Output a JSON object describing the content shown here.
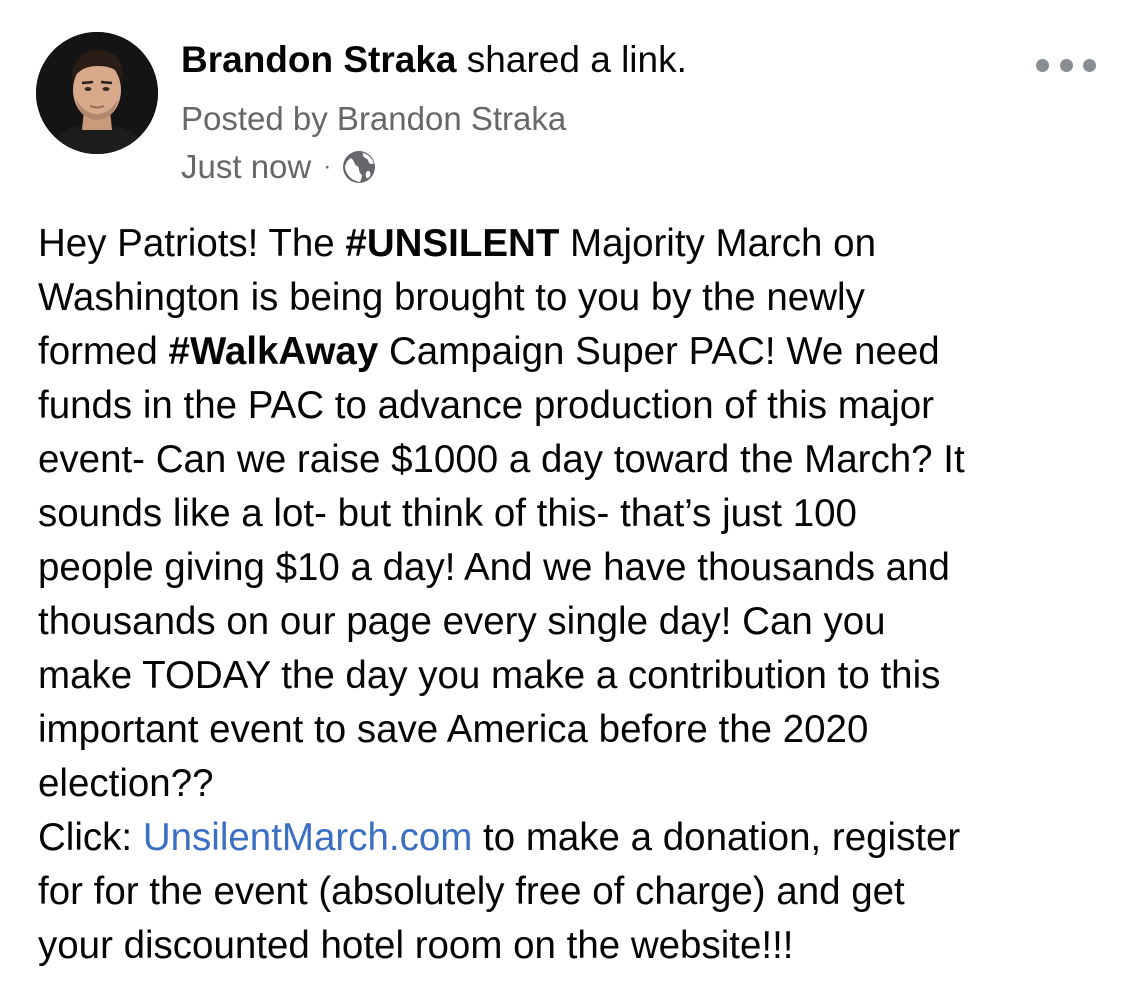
{
  "post": {
    "author": "Brandon Straka",
    "action": " shared a link.",
    "posted_by": "Posted by Brandon Straka",
    "timestamp": "Just now",
    "separator": "·",
    "privacy_icon": "globe-icon",
    "menu_icon": "more-options-icon",
    "body": {
      "line1_a": "Hey Patriots! The ",
      "line1_hashtag": "#UNSILENT",
      "line1_b": " Majority March on",
      "line2": "Washington is being brought to you by the newly",
      "line3_a": "formed ",
      "line3_hashtag": "#WalkAway",
      "line3_b": " Campaign Super PAC! We need",
      "line4": "funds in the PAC to advance production of this major",
      "line5": "event- Can we raise $1000 a day toward the March? It",
      "line6": "sounds like a lot- but think of this- that’s just 100",
      "line7": "people giving $10 a day! And we have thousands and",
      "line8": "thousands on our page every single day! Can you",
      "line9": "make TODAY the day you make a contribution to this",
      "line10": "important event to save America before the 2020",
      "line11": "election??",
      "line12_a": "Click: ",
      "line12_link": "UnsilentMarch.com",
      "line12_b": " to make a donation, register",
      "line13": "for for the event (absolutely free of charge) and get",
      "line14": "your discounted hotel room on the website!!!"
    }
  },
  "colors": {
    "text": "#050505",
    "meta": "#65676b",
    "link": "#3b6fc4",
    "icon": "#8a8d91"
  }
}
